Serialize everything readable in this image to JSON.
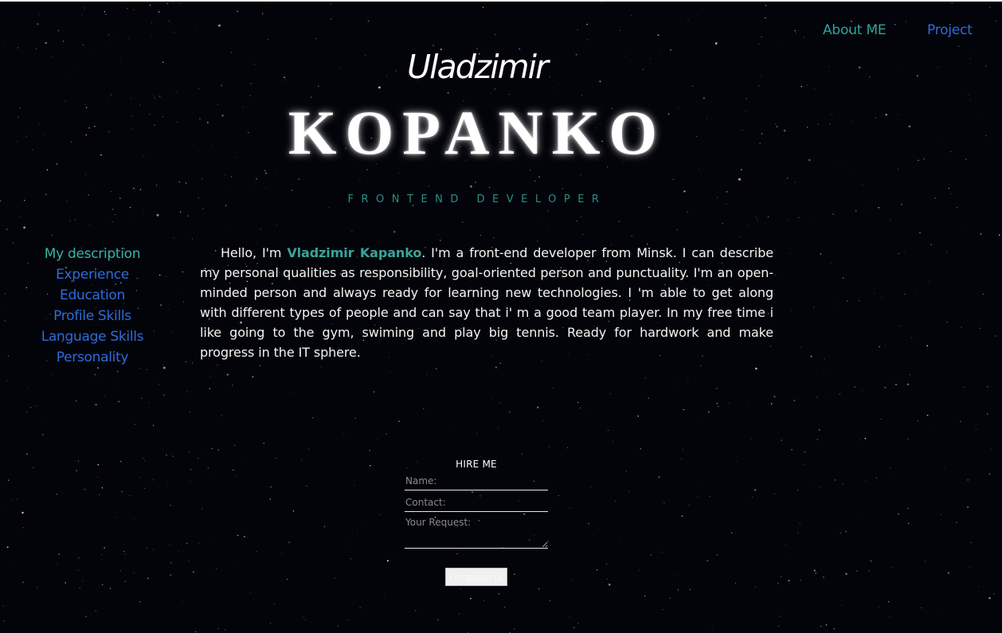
{
  "nav": {
    "about_label": "About ME",
    "project_label": "Project"
  },
  "header": {
    "first_name": "Uladzimir",
    "last_name": "KOPANKO",
    "role": "FRONTEND DEVELOPER"
  },
  "side_nav": {
    "items": [
      {
        "label": "My description"
      },
      {
        "label": "Experience"
      },
      {
        "label": "Education"
      },
      {
        "label": "Profile Skills"
      },
      {
        "label": "Language Skills"
      },
      {
        "label": "Personality"
      }
    ]
  },
  "description": {
    "intro": "Hello, I'm ",
    "name": "Vladzimir Kapanko",
    "body": ". I'm a front-end developer from Minsk. I can describe my personal qualities as responsibility, goal-oriented person and punctuality. I'm an open-minded person and always ready for learning new technologies. I 'm able to get along with different types of people and can say that i' m a good team player. In my free time i like going to the gym, swiming and play big tennis. Ready for hardwork and make progress in the IT sphere."
  },
  "hire_form": {
    "title": "HIRE ME",
    "name_placeholder": "Name:",
    "contact_placeholder": "Contact:",
    "request_placeholder": "Your Request:",
    "submit_label": "Отправить"
  },
  "colors": {
    "background": "#03040a",
    "accent_teal": "#2fa39a",
    "link_blue": "#2f6bd8"
  }
}
